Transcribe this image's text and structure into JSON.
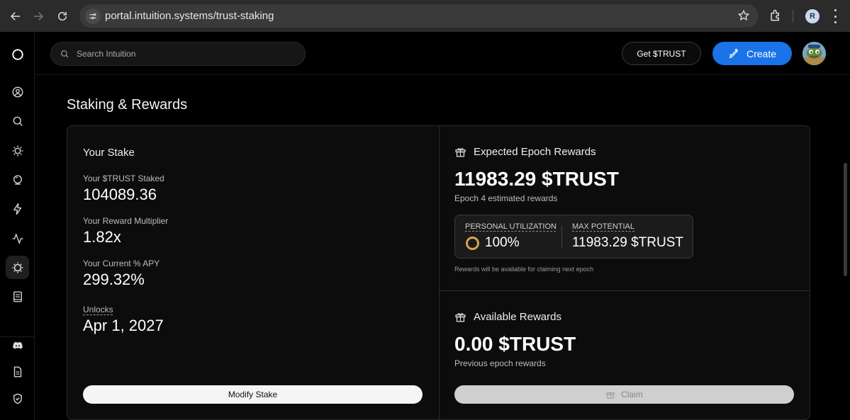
{
  "browser": {
    "url": "portal.intuition.systems/trust-staking",
    "profile_initial": "R"
  },
  "topbar": {
    "search_placeholder": "Search Intuition",
    "get_trust_label": "Get $TRUST",
    "create_label": "Create"
  },
  "sidebar": {
    "items": [
      "profile-icon",
      "search-icon",
      "sun-icon",
      "crystal-ball-icon",
      "lightning-icon",
      "activity-icon",
      "staking-icon",
      "book-icon",
      "discord-icon",
      "document-icon",
      "shield-icon"
    ],
    "active": "staking-icon"
  },
  "page": {
    "title": "Staking & Rewards"
  },
  "stake": {
    "heading": "Your Stake",
    "staked_label": "Your $TRUST Staked",
    "staked_value": "104089.36",
    "multiplier_label": "Your Reward Multiplier",
    "multiplier_value": "1.82x",
    "apy_label": "Your Current % APY",
    "apy_value": "299.32%",
    "unlocks_label": "Unlocks",
    "unlocks_value": "Apr 1, 2027",
    "modify_label": "Modify Stake"
  },
  "epoch": {
    "heading": "Expected Epoch Rewards",
    "amount": "11983.29 $TRUST",
    "subtitle": "Epoch 4 estimated rewards",
    "utilization_label": "PERSONAL UTILIZATION",
    "utilization_value": "100%",
    "max_label": "MAX POTENTIAL",
    "max_value": "11983.29 $TRUST",
    "note": "Rewards will be available for claiming next epoch"
  },
  "available": {
    "heading": "Available Rewards",
    "amount": "0.00 $TRUST",
    "subtitle": "Previous epoch rewards",
    "claim_label": "Claim"
  },
  "colors": {
    "accent": "#1a73e8",
    "ring": "#d4a44c",
    "card_bg": "#0c0c0c"
  }
}
